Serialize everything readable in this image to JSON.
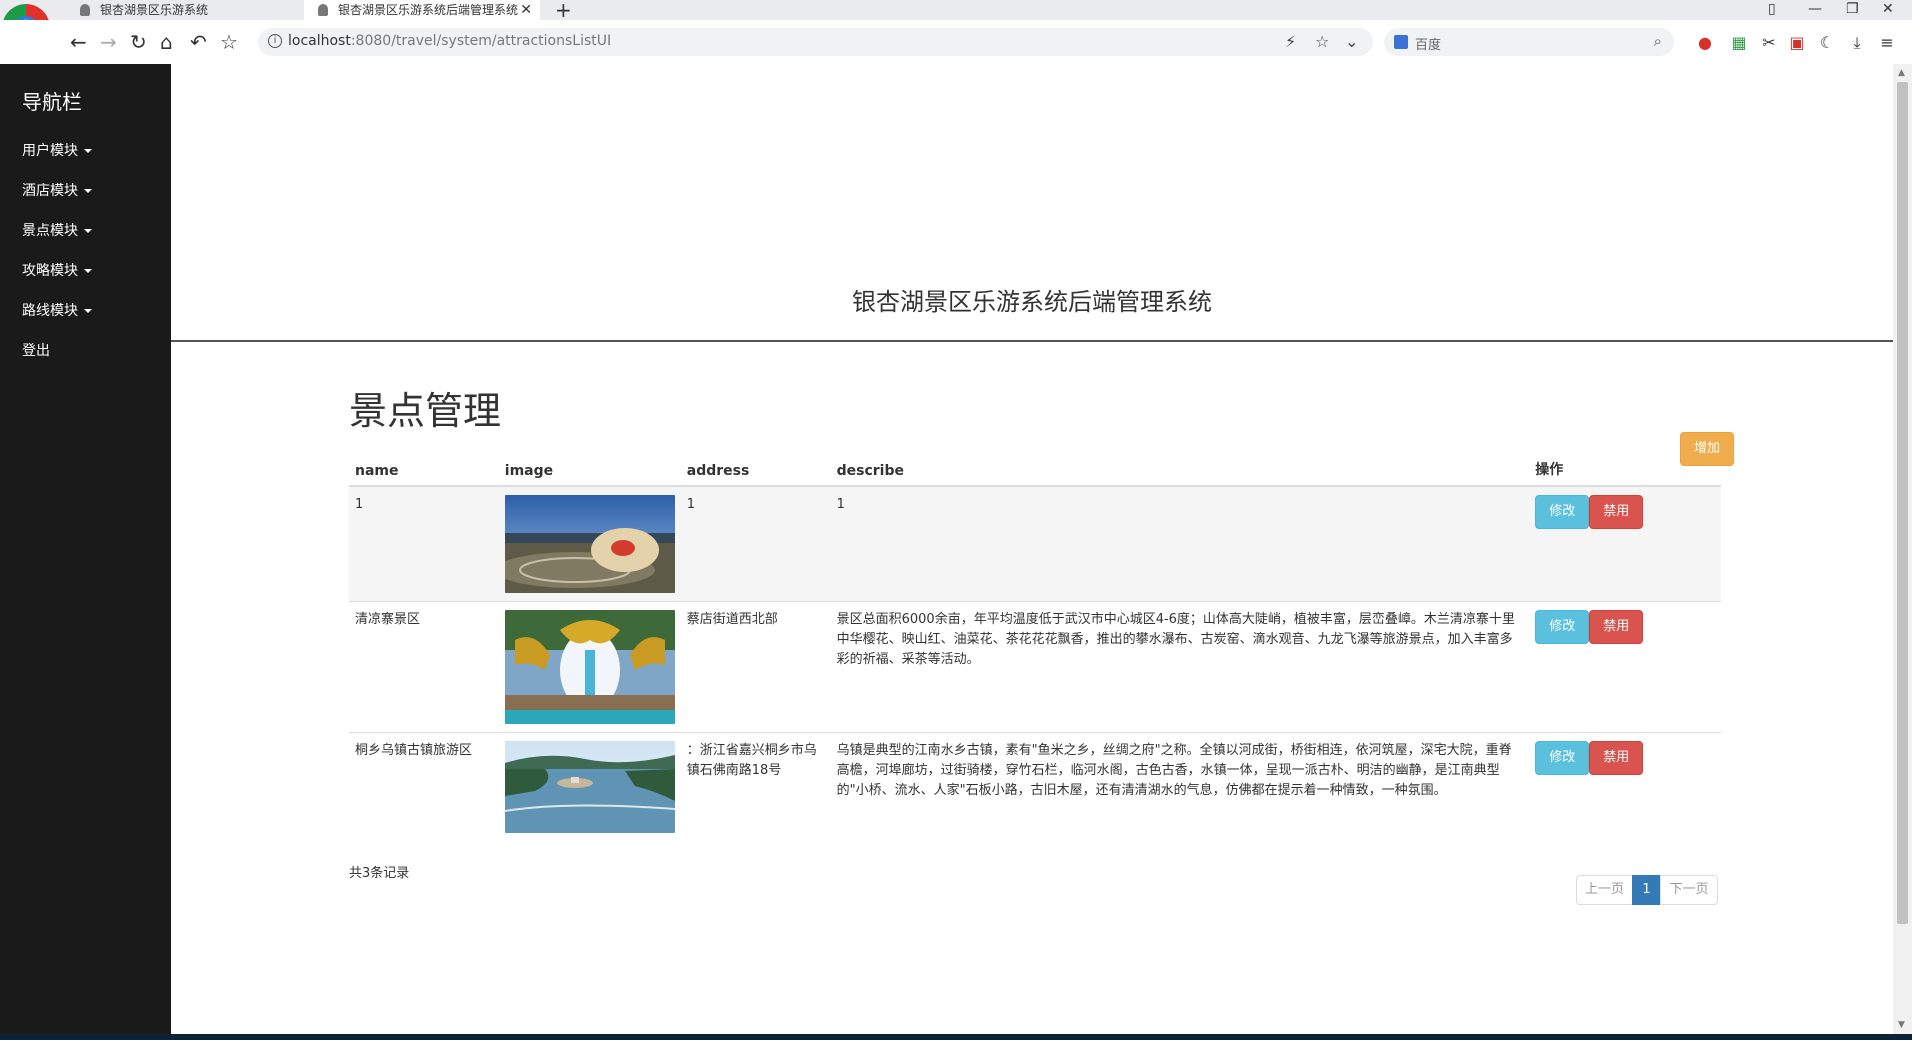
{
  "browser": {
    "tabs": [
      {
        "title": "银杏湖景区乐游系统"
      },
      {
        "title": "银杏湖景区乐游系统后端管理系统"
      }
    ],
    "url_host": "localhost",
    "url_rest": ":8080/travel/system/attractionsListUI",
    "search_placeholder": "百度"
  },
  "sidebar": {
    "brand": "导航栏",
    "items": [
      {
        "label": "用户模块",
        "caret": true
      },
      {
        "label": "酒店模块",
        "caret": true
      },
      {
        "label": "景点模块",
        "caret": true
      },
      {
        "label": "攻略模块",
        "caret": true
      },
      {
        "label": "路线模块",
        "caret": true
      },
      {
        "label": "登出",
        "caret": false
      }
    ]
  },
  "main": {
    "system_title": "银杏湖景区乐游系统后端管理系统",
    "page_title": "景点管理",
    "add_label": "增加",
    "columns": [
      "name",
      "image",
      "address",
      "describe",
      "操作"
    ],
    "rows": [
      {
        "name": "1",
        "address": "1",
        "describe": "1",
        "image": "rock-landscape"
      },
      {
        "name": "清凉寨景区",
        "address": "蔡店街道西北部",
        "describe": "景区总面积6000余亩，年平均温度低于武汉市中心城区4-6度；山体高大陡峭，植被丰富，层峦叠嶂。木兰清凉寨十里中华樱花、映山红、油菜花、茶花花花飘香，推出的攀水瀑布、古炭窑、滴水观音、九龙飞瀑等旅游景点，加入丰富多彩的祈福、采茶等活动。",
        "image": "dragon-fountain"
      },
      {
        "name": "桐乡乌镇古镇旅游区",
        "address": "：浙江省嘉兴桐乡市乌镇石佛南路18号",
        "describe": "乌镇是典型的江南水乡古镇，素有\"鱼米之乡，丝绸之府\"之称。全镇以河成街，桥街相连，依河筑屋，深宅大院，重脊高檐，河埠廊坊，过街骑楼，穿竹石栏，临河水阁，古色古香，水镇一体，呈现一派古朴、明洁的幽静，是江南典型的\"小桥、流水、人家\"石板小路，古旧木屋，还有清清湖水的气息，仿佛都在提示着一种情致，一种氛围。",
        "image": "lake-aerial"
      }
    ],
    "edit_label": "修改",
    "disable_label": "禁用",
    "record_count": "共3条记录",
    "pager": {
      "prev": "上一页",
      "current": "1",
      "next": "下一页"
    }
  }
}
